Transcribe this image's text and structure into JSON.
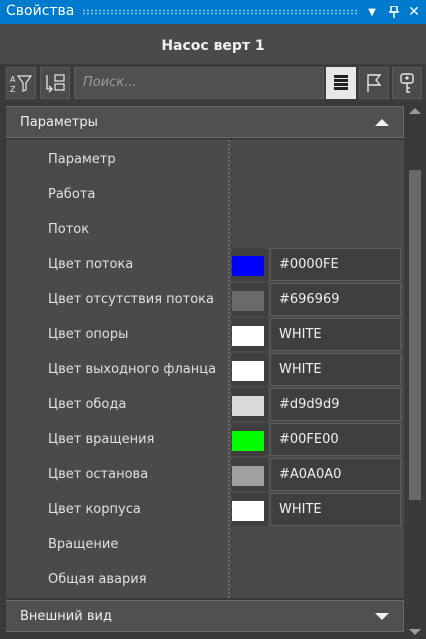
{
  "window": {
    "title": "Свойства"
  },
  "object": {
    "title": "Насос верт 1"
  },
  "toolbar": {
    "search_placeholder": "Поиск..."
  },
  "sections": {
    "params": {
      "label": "Параметры"
    },
    "appearance": {
      "label": "Внешний вид"
    }
  },
  "properties": [
    {
      "name": "Параметр"
    },
    {
      "name": "Работа"
    },
    {
      "name": "Поток"
    },
    {
      "name": "Цвет потока",
      "value": "#0000FE",
      "color": "#0000FE"
    },
    {
      "name": "Цвет отсутствия потока",
      "value": "#696969",
      "color": "#696969"
    },
    {
      "name": "Цвет опоры",
      "value": "WHITE",
      "color": "#FFFFFF"
    },
    {
      "name": "Цвет выходного фланца",
      "value": "WHITE",
      "color": "#FFFFFF"
    },
    {
      "name": "Цвет обода",
      "value": "#d9d9d9",
      "color": "#d9d9d9"
    },
    {
      "name": "Цвет вращения",
      "value": "#00FE00",
      "color": "#00FE00"
    },
    {
      "name": "Цвет останова",
      "value": "#A0A0A0",
      "color": "#A0A0A0"
    },
    {
      "name": "Цвет корпуса",
      "value": "WHITE",
      "color": "#FFFFFF"
    },
    {
      "name": "Вращение"
    },
    {
      "name": "Общая авария"
    }
  ]
}
